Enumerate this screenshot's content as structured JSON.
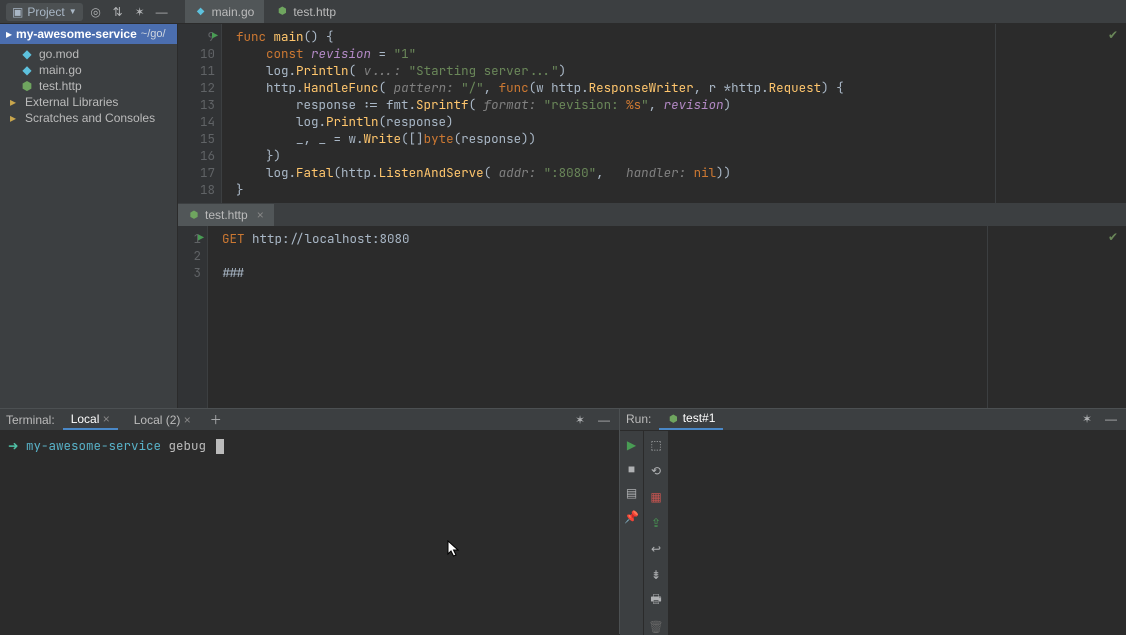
{
  "toolbar": {
    "project_label": "Project"
  },
  "editor_tabs": {
    "tab1": "main.go",
    "tab2": "test.http"
  },
  "sidebar": {
    "project_name": "my-awesome-service",
    "project_path": "~/go/",
    "files": {
      "f0": "go.mod",
      "f1": "main.go",
      "f2": "test.http"
    },
    "ext_lib": "External Libraries",
    "scratches": "Scratches and Consoles"
  },
  "editor1": {
    "lines": {
      "l9": "9",
      "l10": "10",
      "l11": "11",
      "l12": "12",
      "l13": "13",
      "l14": "14",
      "l15": "15",
      "l16": "16",
      "l17": "17",
      "l18": "18"
    },
    "code": {
      "l9_k1": "func ",
      "l9_fn": "main",
      "l9_t": "() {",
      "l10_k1": "const ",
      "l10_v": "revision",
      "l10_t": " = ",
      "l10_s": "\"1\"",
      "l11_a": "log.",
      "l11_b": "Println",
      "l11_c": "(",
      "l11_h": " v...: ",
      "l11_s": "\"Starting server...\"",
      "l11_d": ")",
      "l12_a": "http.",
      "l12_b": "HandleFunc",
      "l12_c": "(",
      "l12_h1": " pattern: ",
      "l12_s": "\"/\"",
      "l12_d": ", ",
      "l12_k": "func",
      "l12_e": "(w http.",
      "l12_t1": "ResponseWriter",
      "l12_f": ", r *http.",
      "l12_t2": "Request",
      "l12_g": ") {",
      "l13_a": "response := fmt.",
      "l13_b": "Sprintf",
      "l13_c": "(",
      "l13_h": " format: ",
      "l13_s1": "\"revision: ",
      "l13_s2": "%s",
      "l13_s3": "\"",
      "l13_d": ", ",
      "l13_v": "revision",
      "l13_e": ")",
      "l14_a": "log.",
      "l14_b": "Println",
      "l14_c": "(response)",
      "l15_a": "_, _ = w.",
      "l15_b": "Write",
      "l15_c": "([]",
      "l15_k": "byte",
      "l15_d": "(response))",
      "l16_a": "})",
      "l17_a": "log.",
      "l17_b": "Fatal",
      "l17_c": "(http.",
      "l17_d": "ListenAndServe",
      "l17_e": "(",
      "l17_h1": " addr: ",
      "l17_s": "\":8080\"",
      "l17_f": ",  ",
      "l17_h2": " handler: ",
      "l17_k": "nil",
      "l17_g": "))",
      "l18_a": "}"
    }
  },
  "editor2": {
    "tab": "test.http",
    "lines": {
      "l1": "1",
      "l2": "2",
      "l3": "3"
    },
    "code": {
      "l1_m": "GET",
      "l1_u": " http://localhost:8080",
      "l3": "###"
    }
  },
  "terminal": {
    "title": "Terminal:",
    "tab1": "Local",
    "tab2": "Local (2)",
    "prompt_dir": "my-awesome-service",
    "prompt_cmd": "gebug "
  },
  "run": {
    "title": "Run:",
    "config": "test#1"
  }
}
